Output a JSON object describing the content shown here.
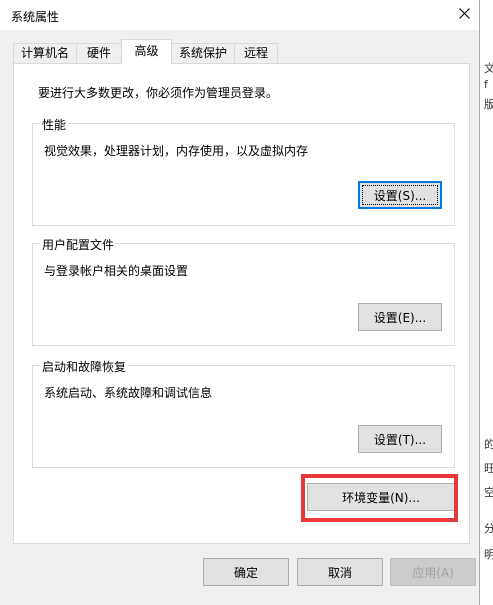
{
  "window": {
    "title": "系统属性",
    "close_glyph": "✕"
  },
  "tabs": [
    {
      "label": "计算机名",
      "active": false
    },
    {
      "label": "硬件",
      "active": false
    },
    {
      "label": "高级",
      "active": true
    },
    {
      "label": "系统保护",
      "active": false
    },
    {
      "label": "远程",
      "active": false
    }
  ],
  "advanced": {
    "admin_notice": "要进行大多数更改，你必须作为管理员登录。",
    "performance": {
      "title": "性能",
      "description": "视觉效果，处理器计划，内存使用，以及虚拟内存",
      "button_label": "设置(S)..."
    },
    "user_profiles": {
      "title": "用户配置文件",
      "description": "与登录帐户相关的桌面设置",
      "button_label": "设置(E)..."
    },
    "startup_recovery": {
      "title": "启动和故障恢复",
      "description": "系统启动、系统故障和调试信息",
      "button_label": "设置(T)..."
    },
    "env_vars_button": "环境变量(N)..."
  },
  "footer": {
    "ok_label": "确定",
    "cancel_label": "取消",
    "apply_label": "应用(A)"
  },
  "background_fragments": [
    "文",
    "f",
    "版",
    "的",
    "旺",
    "空",
    "分",
    "明"
  ],
  "colors": {
    "highlight_box": "#e9383a",
    "focus_border": "#0078d7"
  }
}
